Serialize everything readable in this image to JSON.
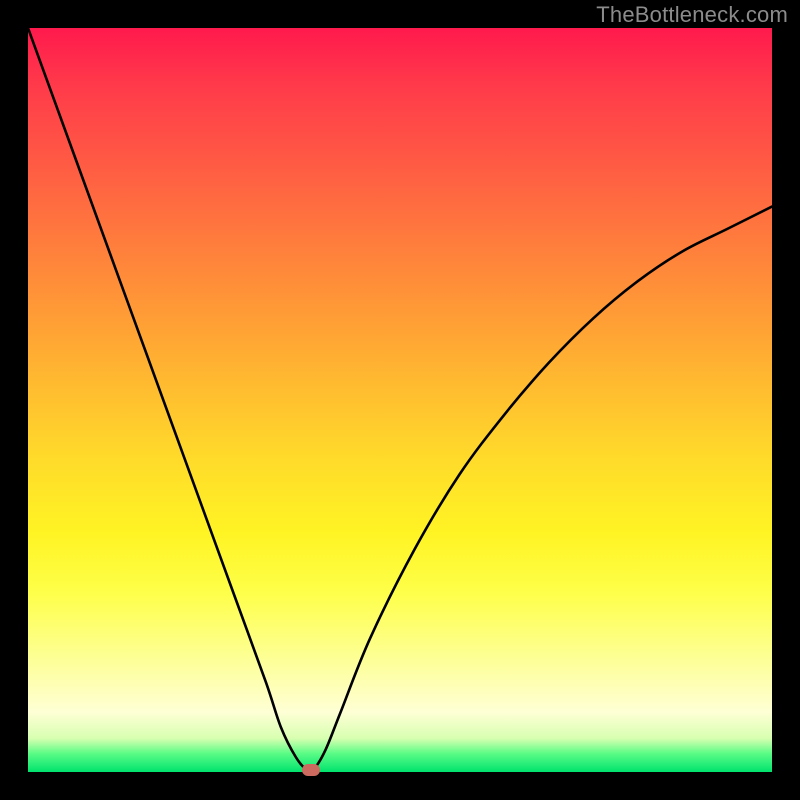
{
  "watermark": "TheBottleneck.com",
  "chart_data": {
    "type": "line",
    "title": "",
    "xlabel": "",
    "ylabel": "",
    "xlim": [
      0,
      100
    ],
    "ylim": [
      0,
      100
    ],
    "gradient_stops": [
      {
        "pos": 0,
        "color": "#ff1a4d"
      },
      {
        "pos": 18,
        "color": "#ff5a44"
      },
      {
        "pos": 38,
        "color": "#ff9a36"
      },
      {
        "pos": 58,
        "color": "#ffdb2a"
      },
      {
        "pos": 76,
        "color": "#feff4a"
      },
      {
        "pos": 92,
        "color": "#feffd5"
      },
      {
        "pos": 97,
        "color": "#5bfc86"
      },
      {
        "pos": 100,
        "color": "#00e36e"
      }
    ],
    "series": [
      {
        "name": "bottleneck-curve",
        "x": [
          0,
          4,
          8,
          12,
          16,
          20,
          24,
          28,
          32,
          34,
          36,
          37.5,
          38.5,
          40,
          42,
          46,
          52,
          58,
          64,
          70,
          76,
          82,
          88,
          94,
          100
        ],
        "values": [
          100,
          89,
          78,
          67,
          56,
          45,
          34,
          23,
          12,
          6,
          2,
          0.3,
          0.5,
          3,
          8,
          18,
          30,
          40,
          48,
          55,
          61,
          66,
          70,
          73,
          76
        ]
      }
    ],
    "marker": {
      "x": 38,
      "y": 0.3,
      "color": "#cc6a5f"
    }
  }
}
